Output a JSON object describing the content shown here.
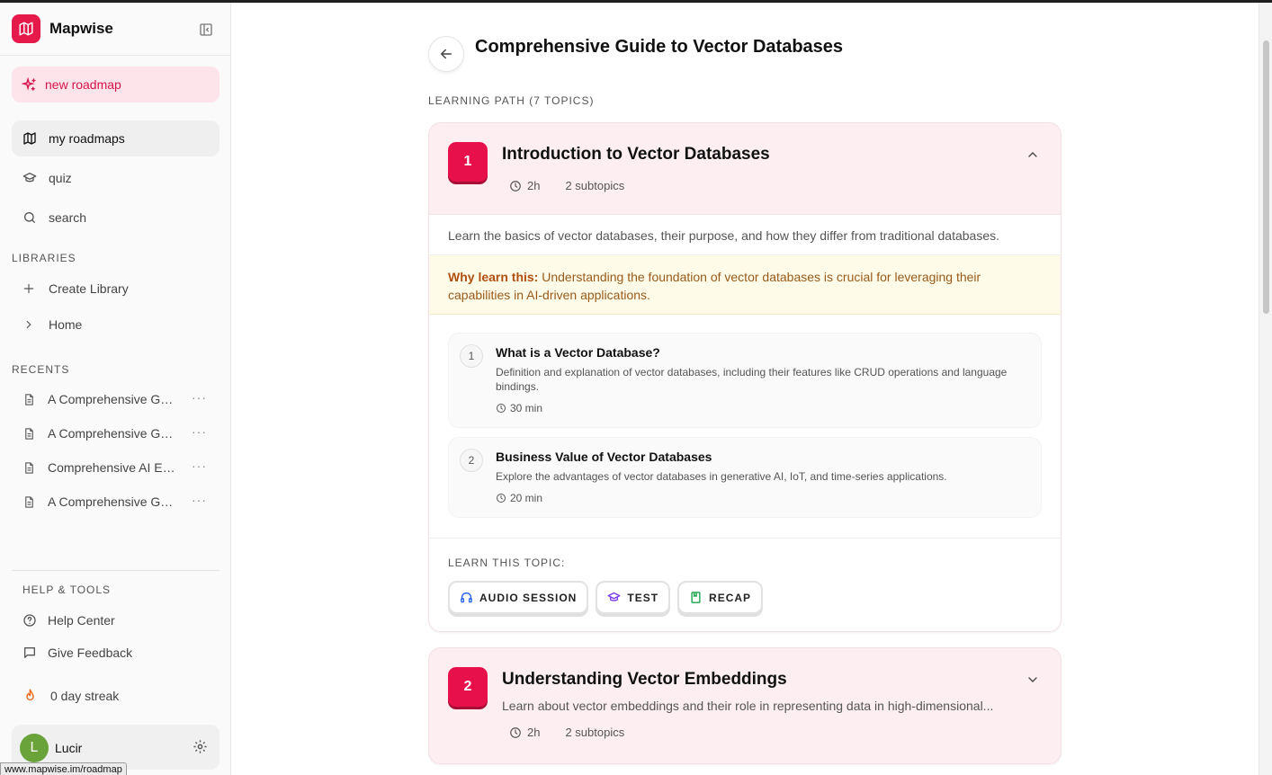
{
  "sidebar": {
    "brand": "Mapwise",
    "new_roadmap": "new roadmap",
    "nav": [
      {
        "label": "my roadmaps",
        "icon": "map-icon"
      },
      {
        "label": "quiz",
        "icon": "graduation-cap-icon"
      },
      {
        "label": "search",
        "icon": "search-icon"
      }
    ],
    "libraries_label": "LIBRARIES",
    "libraries": [
      {
        "label": "Create Library",
        "icon": "plus-icon"
      },
      {
        "label": "Home",
        "icon": "chevron-right-icon"
      }
    ],
    "recents_label": "RECENTS",
    "recents": [
      {
        "label": "A Comprehensive Guide to Vector Databases"
      },
      {
        "label": "A Comprehensive Guide to Vector Databases"
      },
      {
        "label": "Comprehensive AI Engineering"
      },
      {
        "label": "A Comprehensive Guide to Vector Databases"
      }
    ],
    "help_label": "HELP & TOOLS",
    "help": [
      {
        "label": "Help Center",
        "icon": "help-circle-icon"
      },
      {
        "label": "Give Feedback",
        "icon": "message-square-icon"
      }
    ],
    "streak": "0 day streak",
    "user": {
      "initial": "L",
      "name": "Lucir"
    },
    "status_url": "www.mapwise.im/roadmap"
  },
  "main": {
    "title": "Comprehensive Guide to Vector Databases",
    "path_label": "LEARNING PATH (7 TOPICS)",
    "topics": [
      {
        "number": "1",
        "title": "Introduction to Vector Databases",
        "duration": "2h",
        "subtopics_count": "2 subtopics",
        "description": "Learn the basics of vector databases, their purpose, and how they differ from traditional databases.",
        "why_label": "Why learn this:",
        "why_text": " Understanding the foundation of vector databases is crucial for leveraging their capabilities in AI-driven applications.",
        "subtopics": [
          {
            "number": "1",
            "title": "What is a Vector Database?",
            "description": "Definition and explanation of vector databases, including their features like CRUD operations and language bindings.",
            "time": "30 min"
          },
          {
            "number": "2",
            "title": "Business Value of Vector Databases",
            "description": "Explore the advantages of vector databases in generative AI, IoT, and time-series applications.",
            "time": "20 min"
          }
        ],
        "learn_label": "LEARN THIS TOPIC:",
        "learn_buttons": [
          {
            "label": "AUDIO SESSION",
            "icon": "headphones-icon",
            "color": "#2563eb"
          },
          {
            "label": "TEST",
            "icon": "graduation-cap-icon",
            "color": "#7c3aed"
          },
          {
            "label": "RECAP",
            "icon": "book-icon",
            "color": "#16a34a"
          }
        ]
      },
      {
        "number": "2",
        "title": "Understanding Vector Embeddings",
        "description": "Learn about vector embeddings and their role in representing data in high-dimensional...",
        "duration": "2h",
        "subtopics_count": "2 subtopics"
      }
    ]
  },
  "colors": {
    "accent": "#e8104a",
    "accent_soft": "#fde3ea",
    "why_bg": "#fffbe9",
    "why_text": "#9a5a1a"
  }
}
